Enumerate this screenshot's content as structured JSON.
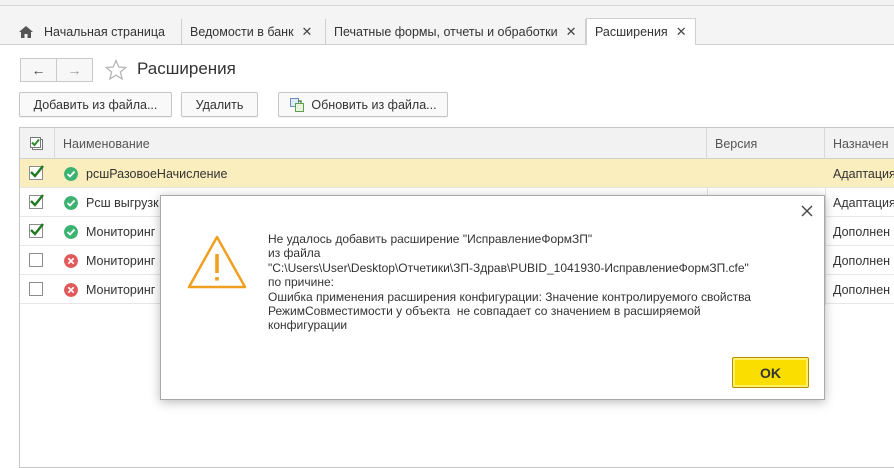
{
  "tabs": [
    {
      "label": "Начальная страница",
      "closable": false
    },
    {
      "label": "Ведомости в банк",
      "closable": true
    },
    {
      "label": "Печатные формы, отчеты и обработки",
      "closable": true
    },
    {
      "label": "Расширения",
      "closable": true,
      "active": true
    }
  ],
  "close_glyph": "✕",
  "header": {
    "back_glyph": "←",
    "forward_glyph": "→",
    "title": "Расширения"
  },
  "toolbar": {
    "add_from_file": "Добавить из файла...",
    "delete": "Удалить",
    "update_from_file": "Обновить из файла..."
  },
  "table": {
    "columns": [
      "Наименование",
      "Версия",
      "Назначен"
    ],
    "rows": [
      {
        "checked": true,
        "status": "ok",
        "name": "рсшРазовоеНачисление",
        "version": "",
        "purpose": "Адаптация",
        "selected": true
      },
      {
        "checked": true,
        "status": "ok",
        "name": "Рсш выгрузк",
        "version": "",
        "purpose": "Адаптация"
      },
      {
        "checked": true,
        "status": "ok",
        "name": "Мониторинг",
        "version": "",
        "purpose": "Дополнен"
      },
      {
        "checked": false,
        "status": "error",
        "name": "Мониторинг",
        "version": "",
        "purpose": "Дополнен"
      },
      {
        "checked": false,
        "status": "error",
        "name": "Мониторинг",
        "version": "",
        "purpose": "Дополнен"
      }
    ]
  },
  "dialog": {
    "lines": [
      "Не удалось добавить расширение \"ИсправлениеФормЗП\"",
      "из файла",
      "\"C:\\Users\\User\\Desktop\\Отчетики\\ЗП-Здрав\\PUBID_1041930-ИсправлениеФормЗП.cfe\"",
      "по причине:",
      "Ошибка применения расширения конфигурации: Значение контролируемого свойства",
      "РежимСовместимости у объекта  не совпадает со значением в расширяемой",
      "конфигурации"
    ],
    "ok_label": "OK"
  },
  "colors": {
    "selected_row": "#fbeebe",
    "ok_button": "#f9de00",
    "status_ok": "#3cb371",
    "status_error": "#e05a5a",
    "warning": "#f0a020"
  }
}
